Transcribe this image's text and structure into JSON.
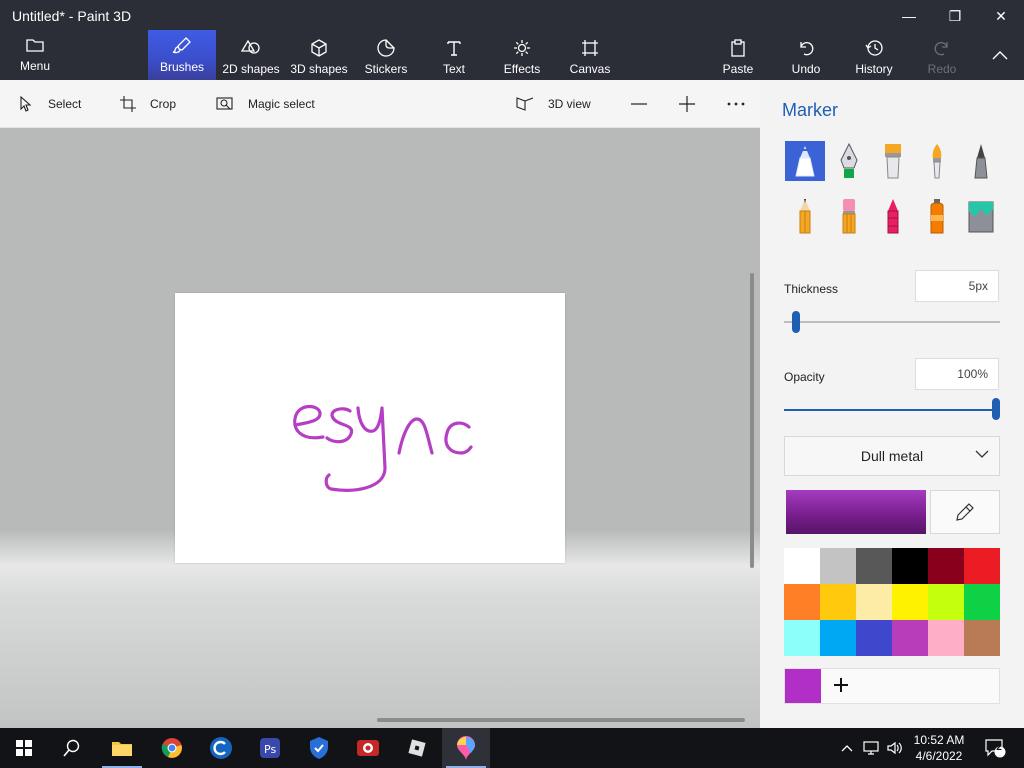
{
  "window": {
    "title": "Untitled* - Paint 3D",
    "minimize_symbol": "—",
    "maximize_symbol": "❐",
    "close_symbol": "✕"
  },
  "ribbon": {
    "menu_label": "Menu",
    "tabs": [
      {
        "label": "Brushes",
        "icon": "brush-icon",
        "active": true
      },
      {
        "label": "2D shapes",
        "icon": "shapes-2d-icon"
      },
      {
        "label": "3D shapes",
        "icon": "cube-icon"
      },
      {
        "label": "Stickers",
        "icon": "sticker-icon"
      },
      {
        "label": "Text",
        "icon": "text-icon"
      },
      {
        "label": "Effects",
        "icon": "sun-icon"
      },
      {
        "label": "Canvas",
        "icon": "canvas-icon"
      }
    ],
    "actions": [
      {
        "label": "Paste",
        "icon": "paste-icon"
      },
      {
        "label": "Undo",
        "icon": "undo-icon"
      },
      {
        "label": "History",
        "icon": "history-icon"
      },
      {
        "label": "Redo",
        "icon": "redo-icon",
        "disabled": true
      }
    ]
  },
  "toolbar": {
    "select_label": "Select",
    "crop_label": "Crop",
    "magic_select_label": "Magic select",
    "view_3d_label": "3D view",
    "zoom_out_icon": "minus-icon",
    "zoom_in_icon": "plus-icon",
    "more_icon": "ellipsis-icon"
  },
  "panel": {
    "title": "Marker",
    "brushes": [
      {
        "name": "marker-icon",
        "selected": true
      },
      {
        "name": "calligraphy-pen-icon"
      },
      {
        "name": "oil-brush-icon"
      },
      {
        "name": "watercolor-icon"
      },
      {
        "name": "pixel-pen-icon"
      },
      {
        "name": "pencil-icon"
      },
      {
        "name": "eraser-icon"
      },
      {
        "name": "crayon-icon"
      },
      {
        "name": "spray-can-icon"
      },
      {
        "name": "fill-bucket-icon"
      }
    ],
    "thickness_label": "Thickness",
    "thickness_value": "5px",
    "thickness_level": 0.05,
    "opacity_label": "Opacity",
    "opacity_value": "100%",
    "opacity_level": 1.0,
    "finish_label": "Dull metal",
    "current_color": "#8a2aa5",
    "palette": [
      "#ffffff",
      "#c3c3c3",
      "#585858",
      "#000000",
      "#88001b",
      "#ec1c24",
      "#ff7f27",
      "#ffc90e",
      "#fdeca6",
      "#fff200",
      "#c4ff0e",
      "#0ed145",
      "#8cfffb",
      "#00a8f3",
      "#3f48cc",
      "#b83dba",
      "#ffaec8",
      "#b97a56"
    ],
    "custom_color": "#b22fc7"
  },
  "canvas": {
    "drawing_text": "esync",
    "stroke_color": "#b53ec4"
  },
  "taskbar": {
    "apps": [
      {
        "name": "start-icon"
      },
      {
        "name": "search-icon"
      },
      {
        "name": "file-explorer-icon",
        "running": true
      },
      {
        "name": "chrome-icon"
      },
      {
        "name": "ccleaner-icon"
      },
      {
        "name": "app-icon"
      },
      {
        "name": "security-shield-icon"
      },
      {
        "name": "camera-app-icon"
      },
      {
        "name": "roblox-icon"
      },
      {
        "name": "paint-3d-icon",
        "running": true,
        "active": true
      }
    ],
    "time": "10:52 AM",
    "date": "4/6/2022",
    "notification_count": "2"
  }
}
